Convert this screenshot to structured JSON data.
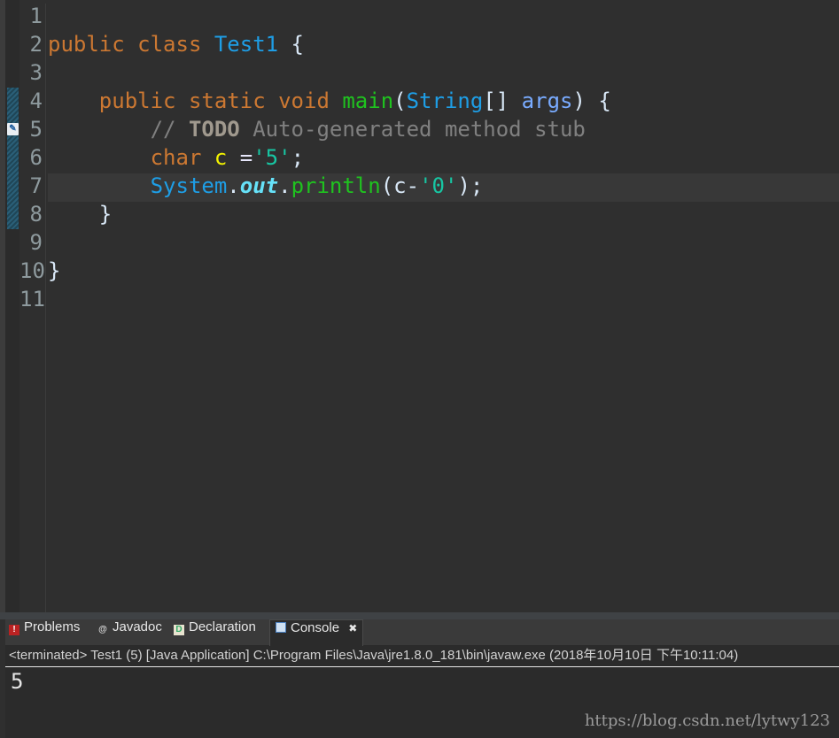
{
  "editor": {
    "line_numbers": [
      "1",
      "2",
      "3",
      "4",
      "5",
      "6",
      "7",
      "8",
      "9",
      "10",
      "11"
    ],
    "ruler_icon_name": "task-marker-icon"
  },
  "code": {
    "l2": {
      "kw1": "public",
      "kw2": "class",
      "cls": "Test1",
      "rest": " {"
    },
    "l4": {
      "indent": "    ",
      "kw1": "public",
      "kw2": "static",
      "kw3": "void",
      "method": "main",
      "p1": "(",
      "type": "String",
      "p2": "[] ",
      "param": "args",
      "p3": ") {"
    },
    "l5": {
      "indent": "        ",
      "slashes": "// ",
      "todo": "TODO",
      "text": " Auto-generated method stub"
    },
    "l6": {
      "indent": "        ",
      "kw": "char",
      "var": "c",
      "op": " =",
      "str": "'5'",
      "end": ";"
    },
    "l7": {
      "indent": "        ",
      "cls": "System",
      "dot1": ".",
      "field": "out",
      "dot2": ".",
      "method": "println",
      "p1": "(c-",
      "str": "'0'",
      "end": ");"
    },
    "l8": {
      "indent": "    ",
      "text": "}"
    },
    "l10": {
      "text": "}"
    }
  },
  "panel": {
    "tabs": {
      "problems": "Problems",
      "javadoc": "Javadoc",
      "declaration": "Declaration",
      "console": "Console",
      "console_close": "✖"
    },
    "status": "<terminated> Test1 (5) [Java Application] C:\\Program Files\\Java\\jre1.8.0_181\\bin\\javaw.exe (2018年10月10日 下午10:11:04)",
    "output": "5"
  },
  "watermark": "https://blog.csdn.net/lytwy123",
  "colors": {
    "keyword": "#cc7832",
    "class": "#1e9ee6",
    "method": "#1fc31f",
    "string": "#17c6a3",
    "variable": "#f2f200",
    "comment": "#808080",
    "background": "#2f2f2f"
  }
}
